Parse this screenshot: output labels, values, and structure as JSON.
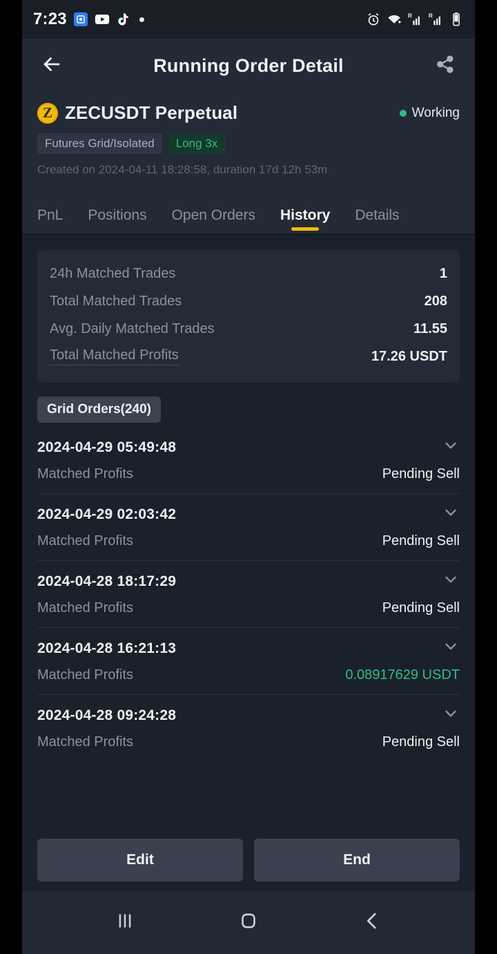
{
  "status_bar": {
    "time": "7:23",
    "left_icons": [
      "screenshot-icon",
      "youtube-icon",
      "tiktok-icon",
      "dot-indicator-icon"
    ],
    "right_icons": [
      "alarm-icon",
      "wifi-icon",
      "signal-roaming-1-icon",
      "signal-roaming-2-icon",
      "battery-icon"
    ]
  },
  "appbar": {
    "back_icon": "back-arrow-icon",
    "title": "Running Order Detail",
    "share_icon": "share-icon"
  },
  "order": {
    "coin_symbol": "Z",
    "pair": "ZECUSDT Perpetual",
    "status_label": "Working",
    "status_color": "#2ebd85",
    "chips": [
      {
        "label": "Futures Grid/Isolated",
        "style": "neutral"
      },
      {
        "label": "Long 3x",
        "style": "long"
      }
    ],
    "created_text": "Created on 2024-04-11 18:28:58, duration 17d 12h 53m"
  },
  "tabs": [
    {
      "label": "PnL",
      "active": false
    },
    {
      "label": "Positions",
      "active": false
    },
    {
      "label": "Open Orders",
      "active": false
    },
    {
      "label": "History",
      "active": true
    },
    {
      "label": "Details",
      "active": false
    }
  ],
  "tab_accent_color": "#f0b90b",
  "stats": [
    {
      "label": "24h Matched Trades",
      "value": "1",
      "dotted": false
    },
    {
      "label": "Total Matched Trades",
      "value": "208",
      "dotted": false
    },
    {
      "label": "Avg. Daily Matched Trades",
      "value": "11.55",
      "dotted": false
    },
    {
      "label": "Total Matched Profits",
      "value": "17.26 USDT",
      "dotted": true
    }
  ],
  "grid_orders_chip": "Grid Orders(240)",
  "history": [
    {
      "time": "2024-04-29 05:49:48",
      "key": "Matched Profits",
      "value": "Pending Sell",
      "green": false
    },
    {
      "time": "2024-04-29 02:03:42",
      "key": "Matched Profits",
      "value": "Pending Sell",
      "green": false
    },
    {
      "time": "2024-04-28 18:17:29",
      "key": "Matched Profits",
      "value": "Pending Sell",
      "green": false
    },
    {
      "time": "2024-04-28 16:21:13",
      "key": "Matched Profits",
      "value": "0.08917629 USDT",
      "green": true
    },
    {
      "time": "2024-04-28 09:24:28",
      "key": "Matched Profits",
      "value": "Pending Sell",
      "green": false
    }
  ],
  "actions": {
    "edit_label": "Edit",
    "end_label": "End"
  },
  "navbar": {
    "recents_icon": "recents-icon",
    "home_icon": "home-icon",
    "back_icon": "nav-back-icon"
  }
}
